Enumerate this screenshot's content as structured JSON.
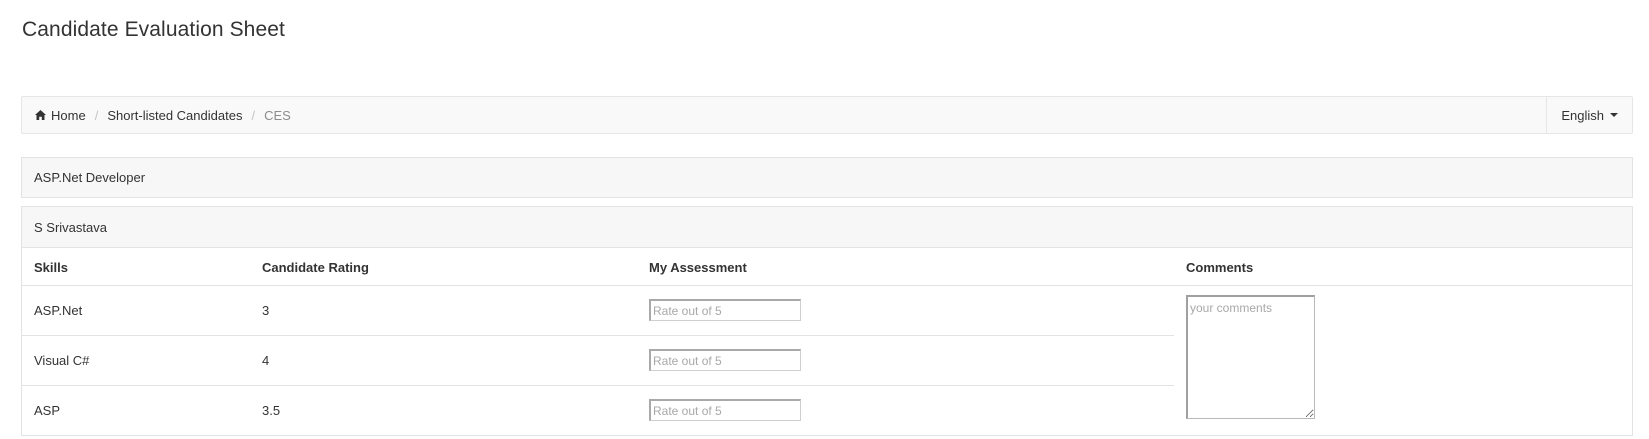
{
  "page": {
    "title": "Candidate Evaluation Sheet"
  },
  "breadcrumb": {
    "home_icon": "home-icon",
    "items": [
      {
        "label": "Home"
      },
      {
        "label": "Short-listed Candidates"
      },
      {
        "label": "CES"
      }
    ],
    "separator": "/"
  },
  "language": {
    "selected": "English",
    "icon": "caret-down-icon"
  },
  "job": {
    "title": "ASP.Net Developer"
  },
  "candidate": {
    "name": "S Srivastava",
    "columns": [
      "Skills",
      "Candidate Rating",
      "My Assessment",
      "Comments"
    ],
    "rows": [
      {
        "skill": "ASP.Net",
        "rating": "3",
        "assessment": "",
        "placeholder": "Rate out of 5"
      },
      {
        "skill": "Visual C#",
        "rating": "4",
        "assessment": "",
        "placeholder": "Rate out of 5"
      },
      {
        "skill": "ASP",
        "rating": "3.5",
        "assessment": "",
        "placeholder": "Rate out of 5"
      }
    ],
    "comments": {
      "value": "",
      "placeholder": "your comments"
    }
  }
}
